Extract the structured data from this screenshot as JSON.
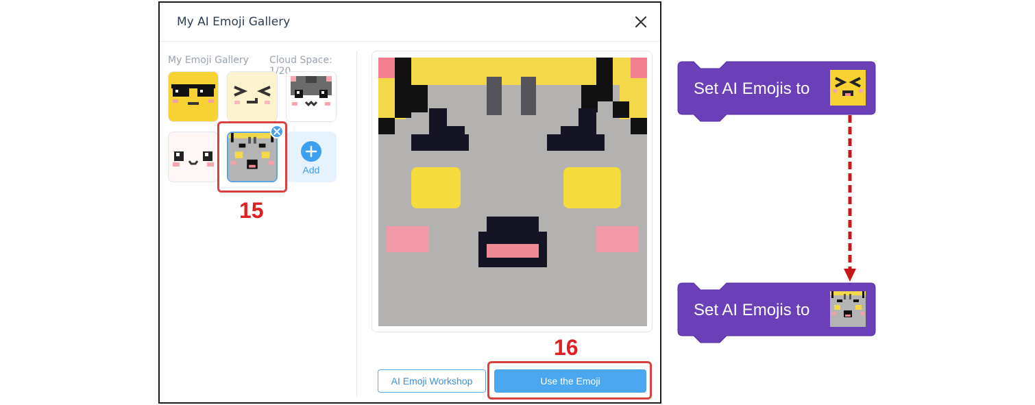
{
  "dialog": {
    "title": "My AI Emoji Gallery",
    "close_icon": "close-icon"
  },
  "gallery": {
    "label": "My Emoji Gallery",
    "cloud_space": "Cloud Space: 1/20",
    "items": [
      {
        "name": "sunglasses-emoji"
      },
      {
        "name": "squint-emoji"
      },
      {
        "name": "cat-emoji"
      },
      {
        "name": "cute-face-emoji"
      },
      {
        "name": "gray-cat-emoji",
        "selected": true
      }
    ],
    "add_label": "Add",
    "delete_icon": "close-icon"
  },
  "annotations": {
    "gallery_step": "15",
    "button_step": "16"
  },
  "buttons": {
    "workshop": "AI Emoji Workshop",
    "use": "Use the Emoji"
  },
  "blocks": [
    {
      "label": "Set AI Emojis to",
      "emoji": "squint-emoji"
    },
    {
      "label": "Set AI Emojis to",
      "emoji": "gray-cat-emoji"
    }
  ],
  "colors": {
    "accent": "#4ba7f0",
    "block": "#6b3fb8",
    "annotation": "#d9413e"
  }
}
